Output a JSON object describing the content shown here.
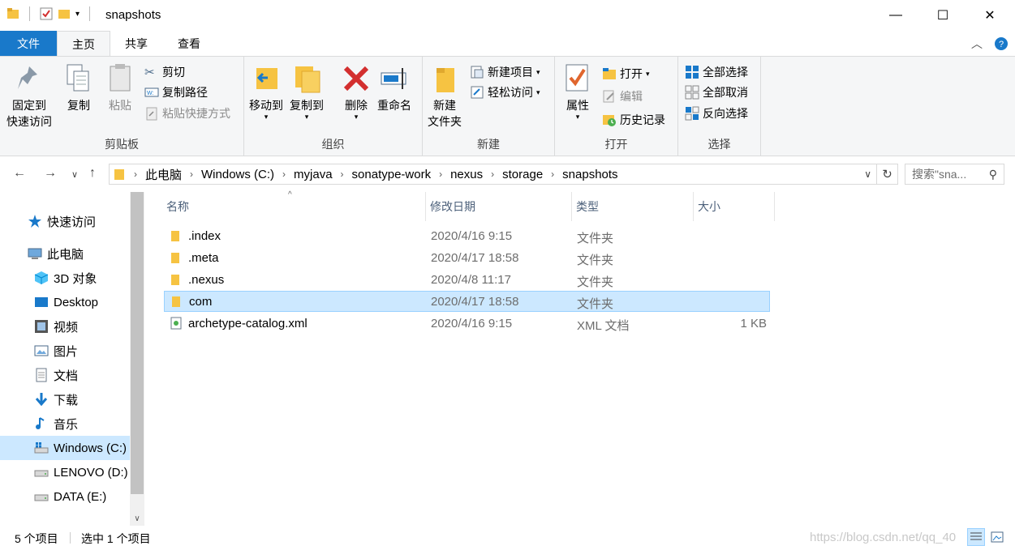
{
  "window": {
    "title": "snapshots"
  },
  "ribbon_tabs": [
    "文件",
    "主页",
    "共享",
    "查看"
  ],
  "ribbon": {
    "clipboard": {
      "label": "剪贴板",
      "pin_line1": "固定到",
      "pin_line2": "快速访问",
      "copy": "复制",
      "paste": "粘贴",
      "cut": "剪切",
      "copy_path": "复制路径",
      "paste_shortcut": "粘贴快捷方式"
    },
    "organize": {
      "label": "组织",
      "move_to": "移动到",
      "copy_to": "复制到",
      "delete": "删除",
      "rename": "重命名"
    },
    "new": {
      "label": "新建",
      "new_folder_line1": "新建",
      "new_folder_line2": "文件夹",
      "new_item": "新建项目",
      "easy_access": "轻松访问"
    },
    "open": {
      "label": "打开",
      "properties": "属性",
      "open": "打开",
      "edit": "编辑",
      "history": "历史记录"
    },
    "select": {
      "label": "选择",
      "select_all": "全部选择",
      "select_none": "全部取消",
      "invert": "反向选择"
    }
  },
  "address": {
    "crumbs": [
      "此电脑",
      "Windows (C:)",
      "myjava",
      "sonatype-work",
      "nexus",
      "storage",
      "snapshots"
    ],
    "search_placeholder": "搜索\"sna..."
  },
  "sidebar": {
    "items": [
      {
        "label": "快速访问",
        "icon": "star-icon"
      },
      {
        "label": "此电脑",
        "icon": "computer-icon"
      },
      {
        "label": "3D 对象",
        "icon": "cube-icon"
      },
      {
        "label": "Desktop",
        "icon": "desktop-icon"
      },
      {
        "label": "视频",
        "icon": "video-icon"
      },
      {
        "label": "图片",
        "icon": "picture-icon"
      },
      {
        "label": "文档",
        "icon": "document-icon"
      },
      {
        "label": "下载",
        "icon": "download-icon"
      },
      {
        "label": "音乐",
        "icon": "music-icon"
      },
      {
        "label": "Windows (C:)",
        "icon": "windows-drive-icon"
      },
      {
        "label": "LENOVO (D:)",
        "icon": "drive-icon"
      },
      {
        "label": "DATA (E:)",
        "icon": "drive-icon"
      }
    ]
  },
  "columns": [
    "名称",
    "修改日期",
    "类型",
    "大小"
  ],
  "files": [
    {
      "name": ".index",
      "date": "2020/4/16 9:15",
      "type": "文件夹",
      "size": ""
    },
    {
      "name": ".meta",
      "date": "2020/4/17 18:58",
      "type": "文件夹",
      "size": ""
    },
    {
      "name": ".nexus",
      "date": "2020/4/8 11:17",
      "type": "文件夹",
      "size": ""
    },
    {
      "name": "com",
      "date": "2020/4/17 18:58",
      "type": "文件夹",
      "size": ""
    },
    {
      "name": "archetype-catalog.xml",
      "date": "2020/4/16 9:15",
      "type": "XML 文档",
      "size": "1 KB"
    }
  ],
  "status": {
    "count": "5 个项目",
    "selected": "选中 1 个项目",
    "watermark": "https://blog.csdn.net/qq_40"
  },
  "colors": {
    "accent": "#1979ca",
    "selection": "#cce8ff",
    "folder": "#f6c342"
  }
}
